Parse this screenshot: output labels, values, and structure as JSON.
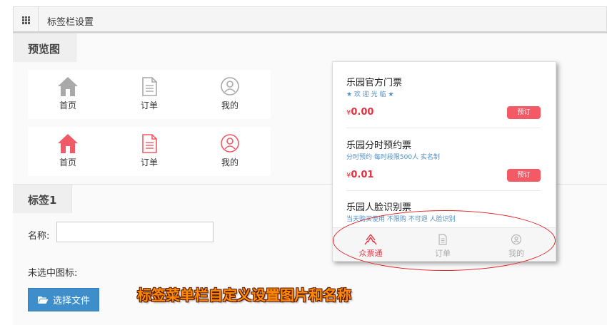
{
  "header": {
    "title": "标签栏设置"
  },
  "preview_section": {
    "title": "预览图"
  },
  "preview_tabs": {
    "unselected": [
      {
        "label": "首页",
        "icon": "home-icon"
      },
      {
        "label": "订单",
        "icon": "order-icon"
      },
      {
        "label": "我的",
        "icon": "user-icon"
      }
    ],
    "selected": [
      {
        "label": "首页",
        "icon": "home-icon"
      },
      {
        "label": "订单",
        "icon": "order-icon"
      },
      {
        "label": "我的",
        "icon": "user-icon"
      }
    ],
    "colors": {
      "unselected": "#a9a9a9",
      "selected": "#f05a67"
    }
  },
  "tab1_section": {
    "title": "标签1",
    "name_label": "名称:",
    "name_value": "",
    "unselected_icon_label": "未选中图标:",
    "choose_file_label": "选择文件"
  },
  "phone_preview": {
    "tickets": [
      {
        "title": "乐园官方门票",
        "subtitle": "★ 欢 迎 光 临 ★",
        "price_symbol": "¥",
        "price": "0.00",
        "button": "预订"
      },
      {
        "title": "乐园分时预约票",
        "subtitle": "分时预约 每时段限500人 实名制",
        "price_symbol": "¥",
        "price": "0.01",
        "button": "预订"
      },
      {
        "title": "乐园人脸识别票",
        "subtitle": "当天购买使用 不限购 不可退 人脸识别"
      }
    ],
    "tabbar": [
      {
        "label": "众票通",
        "icon": "brand-logo-icon",
        "active": true
      },
      {
        "label": "订单",
        "icon": "order-icon",
        "active": false
      },
      {
        "label": "我的",
        "icon": "user-icon",
        "active": false
      }
    ],
    "colors": {
      "price": "#e8303d",
      "accent": "#f35a66",
      "subtitle": "#4a8fc8"
    }
  },
  "annotation": {
    "text": "标签菜单栏自定义设置图片和名称",
    "color": "#ff8a00"
  },
  "colors": {
    "primary_button": "#3d8ecb",
    "highlight_ellipse": "#e41c1c"
  }
}
